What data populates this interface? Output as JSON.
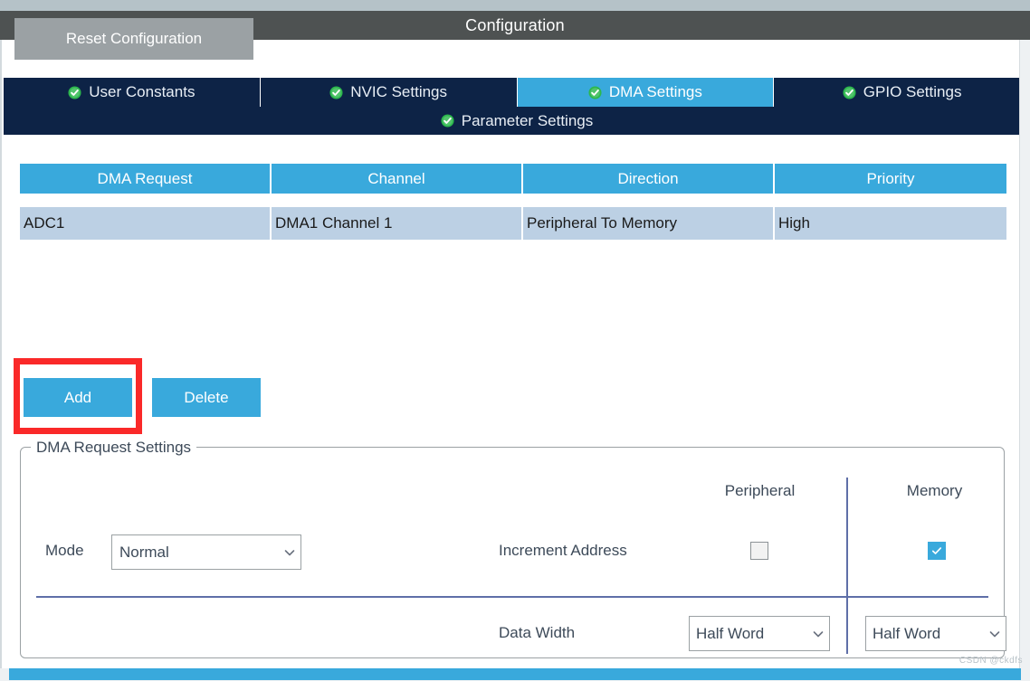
{
  "window": {
    "title": "Configuration"
  },
  "toolbar": {
    "reset_label": "Reset Configuration"
  },
  "tabs": [
    {
      "label": "User Constants",
      "icon": "check-circle-icon",
      "active": false
    },
    {
      "label": "NVIC Settings",
      "icon": "check-circle-icon",
      "active": false
    },
    {
      "label": "DMA Settings",
      "icon": "check-circle-icon",
      "active": true
    },
    {
      "label": "GPIO Settings",
      "icon": "check-circle-icon",
      "active": false
    }
  ],
  "sub_tab": {
    "label": "Parameter Settings",
    "icon": "check-circle-icon"
  },
  "table": {
    "columns": [
      "DMA Request",
      "Channel",
      "Direction",
      "Priority"
    ],
    "rows": [
      [
        "ADC1",
        "DMA1 Channel 1",
        "Peripheral To Memory",
        "High"
      ]
    ]
  },
  "actions": {
    "add_label": "Add",
    "delete_label": "Delete"
  },
  "group": {
    "legend": "DMA Request Settings",
    "column_headers": {
      "peripheral": "Peripheral",
      "memory": "Memory"
    },
    "mode": {
      "label": "Mode",
      "value": "Normal",
      "caret": "chevron-down-icon"
    },
    "increment_address": {
      "label": "Increment Address",
      "peripheral_checked": false,
      "memory_checked": true
    },
    "data_width": {
      "label": "Data Width",
      "peripheral_value": "Half Word",
      "memory_value": "Half Word",
      "caret": "chevron-down-icon"
    }
  },
  "colors": {
    "title_bar": "#4e5252",
    "tab_bar": "#0d2346",
    "accent_blue": "#39a9dc",
    "row_blue": "#bcd0e4",
    "annotation_red": "#fa2929",
    "divider_blue": "#5f6fa8",
    "reset_gray": "#9ba1a4"
  },
  "watermark": {
    "text": "CSDN @ckdfs"
  }
}
